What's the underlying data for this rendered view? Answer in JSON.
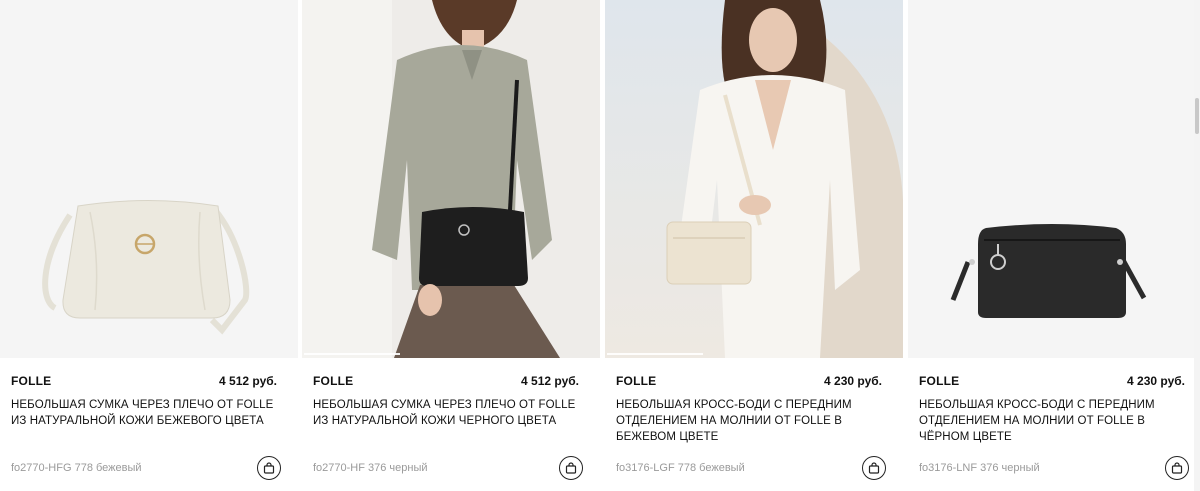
{
  "products": [
    {
      "brand": "FOLLE",
      "price": "4 512 руб.",
      "title": "НЕБОЛЬШАЯ СУМКА ЧЕРЕЗ ПЛЕЧО ОТ FOLLE ИЗ НАТУРАЛЬНОЙ КОЖИ БЕЖЕВОГО ЦВЕТА",
      "sku": "fo2770-HFG 778 бежевый",
      "image": "beige-bag-product-photo",
      "cart_icon": "shopping-bag-icon"
    },
    {
      "brand": "FOLLE",
      "price": "4 512 руб.",
      "title": "НЕБОЛЬШАЯ СУМКА ЧЕРЕЗ ПЛЕЧО ОТ FOLLE ИЗ НАТУРАЛЬНОЙ КОЖИ ЧЕРНОГО ЦВЕТА",
      "sku": "fo2770-HF 376 черный",
      "image": "model-with-black-bag-photo",
      "cart_icon": "shopping-bag-icon"
    },
    {
      "brand": "FOLLE",
      "price": "4 230 руб.",
      "title": "НЕБОЛЬШАЯ КРОСС-БОДИ С ПЕРЕДНИМ ОТДЕЛЕНИЕМ НА МОЛНИИ ОТ FOLLE В БЕЖЕВОМ ЦВЕТЕ",
      "sku": "fo3176-LGF 778 бежевый",
      "image": "model-with-beige-crossbody-photo",
      "cart_icon": "shopping-bag-icon"
    },
    {
      "brand": "FOLLE",
      "price": "4 230 руб.",
      "title": "НЕБОЛЬШАЯ КРОСС-БОДИ С ПЕРЕДНИМ ОТДЕЛЕНИЕМ НА МОЛНИИ ОТ FOLLE В ЧЁРНОМ ЦВЕТЕ",
      "sku": "fo3176-LNF 376 черный",
      "image": "black-crossbody-product-photo",
      "cart_icon": "shopping-bag-icon"
    }
  ],
  "colors": {
    "text": "#111111",
    "sku_text": "#9a9a9a",
    "product_bg": "#f5f5f5"
  }
}
